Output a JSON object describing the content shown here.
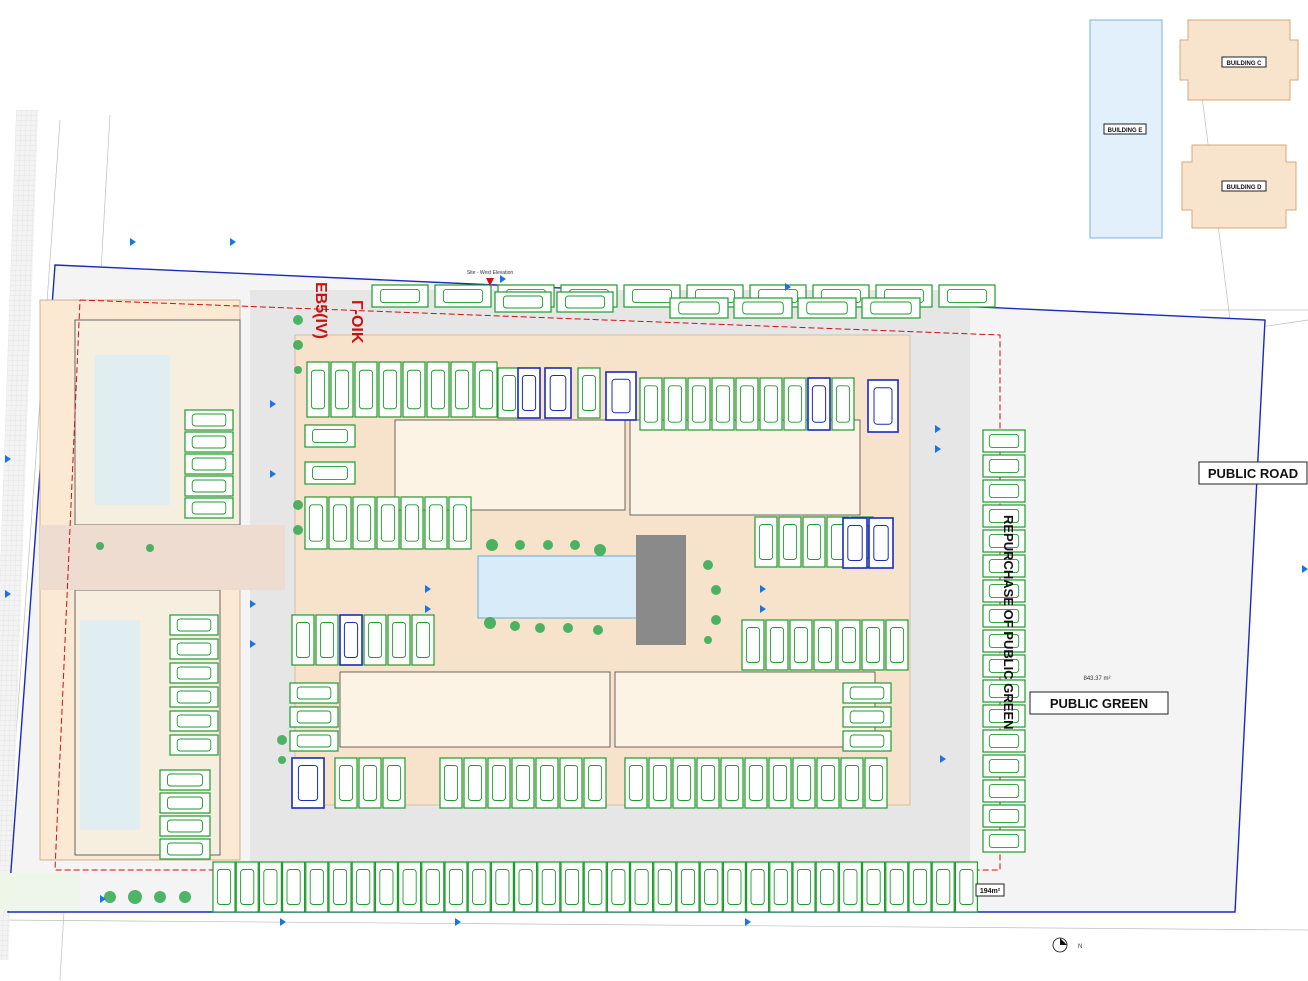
{
  "labels": {
    "public_road": "PUBLIC ROAD",
    "public_green": "PUBLIC GREEN",
    "public_green_area": "843.37 m²",
    "repurchase": "REPURCHASE OF PUBLIC GREEN",
    "zone_code_1": "Γ-ΟΙΚ",
    "zone_code_2": "ΕΒ5(IV)",
    "corner_area": "194m²",
    "site_west_elevation": "Site - West Elevation",
    "north": "N"
  },
  "neighbour_buildings": [
    "BUILDING C",
    "BUILDING E",
    "BUILDING D"
  ],
  "colors": {
    "site_boundary": "#1a2bb8",
    "parking_green": "#1f9a2e",
    "zone_red": "#cc1111",
    "plaza": "#f7e3cc",
    "driveway": "#e6e6e6",
    "public_green_fill": "#e9f2e4",
    "pool": "#d7ecf8",
    "disabled_parking": "#1a2bb8"
  },
  "icons": [
    "car-icon",
    "tree-icon",
    "north-arrow-icon",
    "elevation-marker-icon"
  ]
}
